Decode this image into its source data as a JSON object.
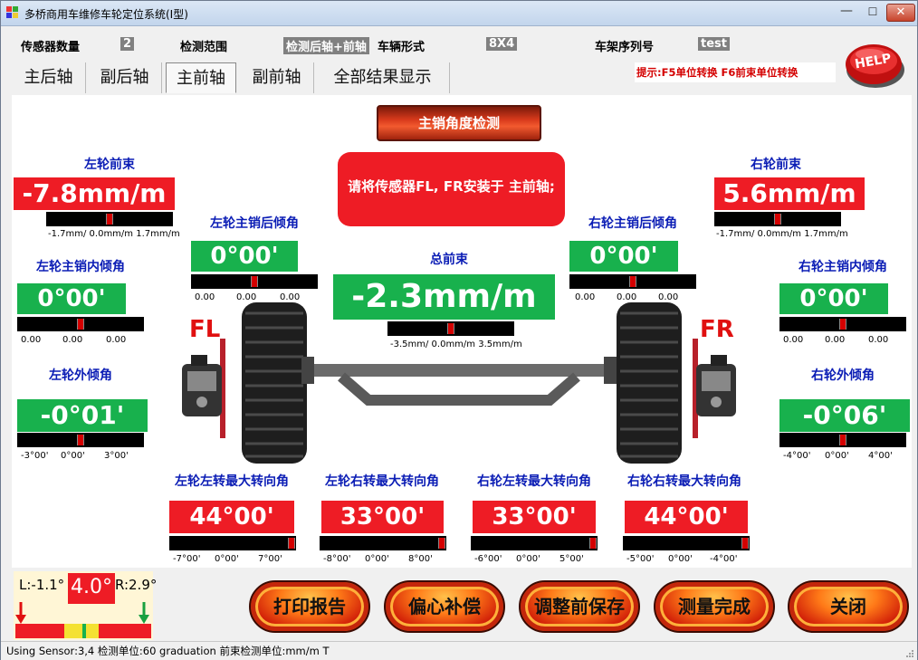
{
  "window": {
    "title": "多桥商用车维修车轮定位系统(I型)",
    "minimize": "—",
    "maximize": "☐",
    "close": "✕"
  },
  "info": {
    "sensor_count_label": "传感器数量",
    "sensor_count": "2",
    "range_label": "检测范围",
    "range_value": "检测后轴+前轴",
    "vehicle_type_label": "车辆形式",
    "vehicle_type": "8X4",
    "frame_serial_label": "车架序列号",
    "frame_serial": "test",
    "hint": "提示:F5单位转换 F6前束单位转换",
    "help": "HELP"
  },
  "tabs": [
    {
      "label": "主后轴"
    },
    {
      "label": "副后轴"
    },
    {
      "label": "主前轴",
      "active": true
    },
    {
      "label": "副前轴"
    },
    {
      "label": "全部结果显示"
    }
  ],
  "pin_button": "主销角度检测",
  "message": "请将传感器FL, FR安装于 主前轴;",
  "fl": "FL",
  "fr": "FR",
  "left_toe": {
    "label": "左轮前束",
    "value": "-7.8mm/m",
    "ticks": "-1.7mm/  0.0mm/m 1.7mm/m",
    "marker": 0.5
  },
  "right_toe": {
    "label": "右轮前束",
    "value": "5.6mm/m",
    "ticks": "-1.7mm/  0.0mm/m 1.7mm/m",
    "marker": 0.5
  },
  "left_caster": {
    "label": "左轮主销后倾角",
    "value": "0°00'",
    "ticks": [
      "0.00",
      "0.00",
      "0.00"
    ],
    "marker": 0.5
  },
  "right_caster": {
    "label": "右轮主销后倾角",
    "value": "0°00'",
    "ticks": [
      "0.00",
      "0.00",
      "0.00"
    ],
    "marker": 0.5
  },
  "total_toe": {
    "label": "总前束",
    "value": "-2.3mm/m",
    "ticks": "-3.5mm/  0.0mm/m 3.5mm/m",
    "marker": 0.5
  },
  "left_kpi": {
    "label": "左轮主销内倾角",
    "value": "0°00'",
    "ticks": [
      "0.00",
      "0.00",
      "0.00"
    ],
    "marker": 0.5
  },
  "right_kpi": {
    "label": "右轮主销内倾角",
    "value": "0°00'",
    "ticks": [
      "0.00",
      "0.00",
      "0.00"
    ],
    "marker": 0.5
  },
  "left_camber": {
    "label": "左轮外倾角",
    "value": "-0°01'",
    "ticks": [
      "-3°00'",
      "0°00'",
      "3°00'"
    ],
    "marker": 0.5
  },
  "right_camber": {
    "label": "右轮外倾角",
    "value": "-0°06'",
    "ticks": [
      "-4°00'",
      "0°00'",
      "4°00'"
    ],
    "marker": 0.5
  },
  "turns": [
    {
      "label": "左轮左转最大转向角",
      "value": "44°00'",
      "ticks": [
        "-7°00'",
        "0°00'",
        "7°00'"
      ]
    },
    {
      "label": "左轮右转最大转向角",
      "value": "33°00'",
      "ticks": [
        "-8°00'",
        "0°00'",
        "8°00'"
      ]
    },
    {
      "label": "右轮左转最大转向角",
      "value": "33°00'",
      "ticks": [
        "-6°00'",
        "0°00'",
        "5°00'"
      ]
    },
    {
      "label": "右轮右转最大转向角",
      "value": "44°00'",
      "ticks": [
        "-5°00'",
        "0°00'",
        "-4°00'"
      ]
    }
  ],
  "gauge": {
    "left": "L:-1.1°",
    "center": "4.0°",
    "right": "R:2.9°"
  },
  "buttons": {
    "print": "打印报告",
    "runout": "偏心补偿",
    "save": "调整前保存",
    "done": "测量完成",
    "close": "关闭"
  },
  "status": "Using Sensor:3,4  检测单位:60 graduation 前束检测单位:mm/m   T"
}
